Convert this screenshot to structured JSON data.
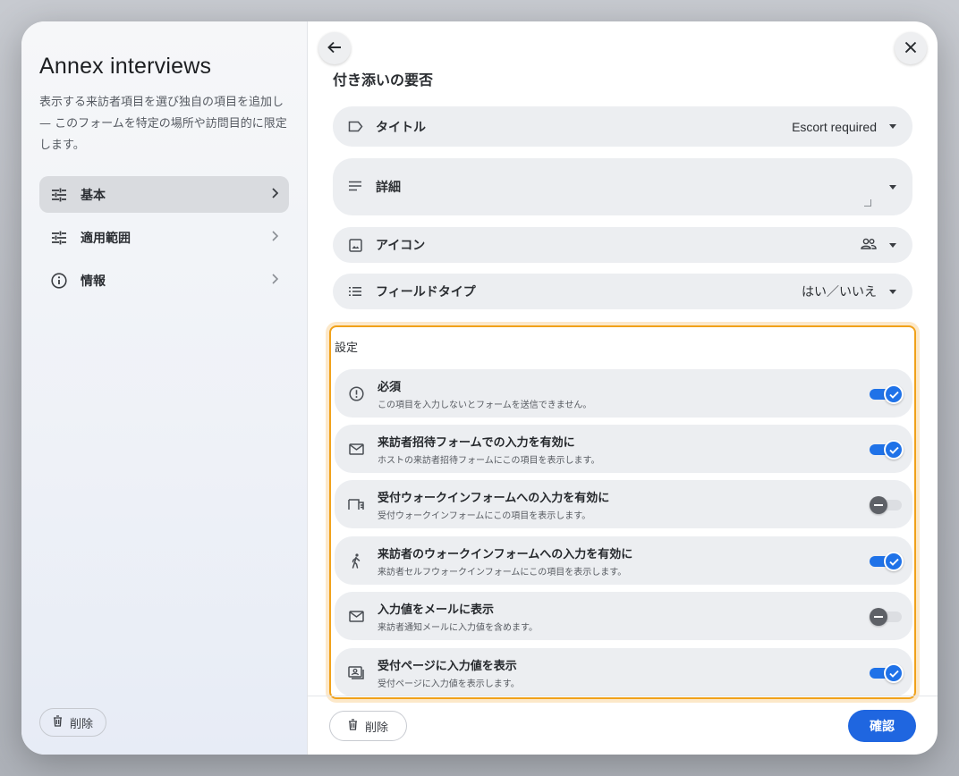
{
  "left_pane": {
    "title": "Annex interviews",
    "description": "表示する来訪者項目を選び独自の項目を追加し — このフォームを特定の場所や訪問目的に限定します。",
    "nav": [
      {
        "label": "基本",
        "icon": "tune-icon",
        "active": true
      },
      {
        "label": "適用範囲",
        "icon": "tune-icon",
        "active": false
      },
      {
        "label": "情報",
        "icon": "info-icon",
        "active": false
      }
    ],
    "delete_label": "削除"
  },
  "right_pane": {
    "section_title": "付き添いの要否",
    "fields": {
      "title": {
        "label": "タイトル",
        "value": "Escort required",
        "icon": "label-icon"
      },
      "details": {
        "label": "詳細",
        "icon": "notes-icon"
      },
      "icon": {
        "label": "アイコン",
        "icon": "image-icon",
        "value_icon": "people-icon"
      },
      "field_type": {
        "label": "フィールドタイプ",
        "value": "はい／いいえ",
        "icon": "list-icon"
      }
    },
    "settings": {
      "title": "設定",
      "rows": [
        {
          "title": "必須",
          "subtitle": "この項目を入力しないとフォームを送信できません。",
          "icon": "alert-circle-icon",
          "on": true
        },
        {
          "title": "来訪者招待フォームでの入力を有効に",
          "subtitle": "ホストの来訪者招待フォームにこの項目を表示します。",
          "icon": "mail-icon",
          "on": true
        },
        {
          "title": "受付ウォークインフォームへの入力を有効に",
          "subtitle": "受付ウォークインフォームにこの項目を表示します。",
          "icon": "desk-icon",
          "on": false
        },
        {
          "title": "来訪者のウォークインフォームへの入力を有効に",
          "subtitle": "来訪者セルフウォークインフォームにこの項目を表示します。",
          "icon": "walk-icon",
          "on": true
        },
        {
          "title": "入力値をメールに表示",
          "subtitle": "来訪者通知メールに入力値を含めます。",
          "icon": "mail-icon",
          "on": false
        },
        {
          "title": "受付ページに入力値を表示",
          "subtitle": "受付ページに入力値を表示します。",
          "icon": "contact-card-icon",
          "on": true
        }
      ]
    },
    "footer": {
      "delete_label": "削除",
      "confirm_label": "確認"
    }
  },
  "colors": {
    "accent": "#1f66e0",
    "highlight_border": "#f0a11a",
    "toggle_on": "#1f72e8"
  }
}
